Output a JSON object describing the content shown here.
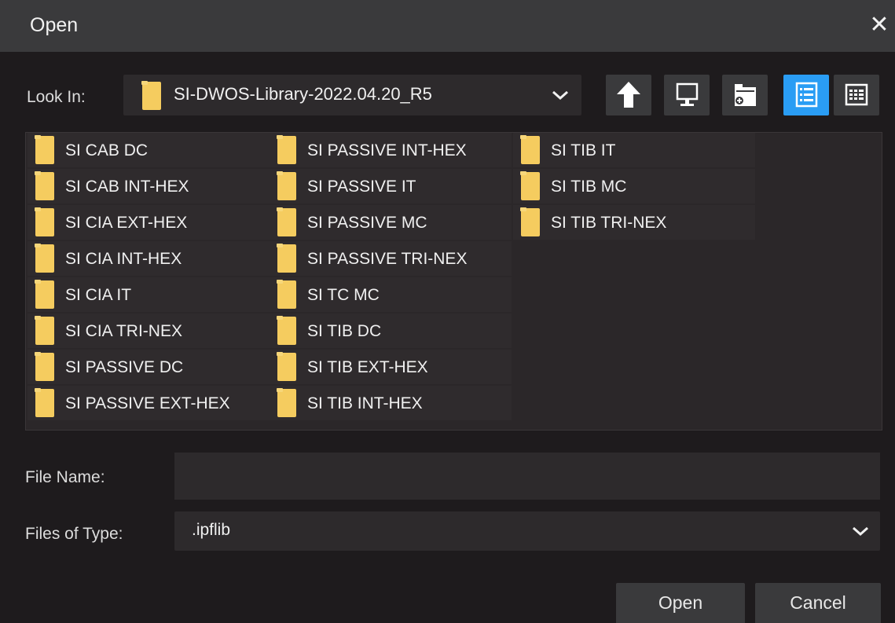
{
  "dialog": {
    "title": "Open",
    "close_glyph": "✕"
  },
  "look_in": {
    "label": "Look In:",
    "value": "SI-DWOS-Library-2022.04.20_R5",
    "icon": "folder-icon"
  },
  "toolbar": {
    "buttons": [
      {
        "name": "up-one-level-button",
        "icon": "arrow-up-icon"
      },
      {
        "name": "desktop-button",
        "icon": "monitor-icon"
      },
      {
        "name": "new-folder-button",
        "icon": "new-folder-icon"
      },
      {
        "name": "list-view-button",
        "icon": "list-view-icon",
        "active": true
      },
      {
        "name": "details-view-button",
        "icon": "details-view-icon",
        "active": false
      }
    ],
    "active_color": "#2a9df4"
  },
  "files": {
    "columns": [
      [
        "SI CAB DC",
        "SI CAB INT-HEX",
        "SI CIA EXT-HEX",
        "SI CIA INT-HEX",
        "SI CIA IT",
        "SI CIA TRI-NEX",
        "SI PASSIVE DC",
        "SI PASSIVE EXT-HEX"
      ],
      [
        "SI PASSIVE INT-HEX",
        "SI PASSIVE IT",
        "SI PASSIVE MC",
        "SI PASSIVE TRI-NEX",
        "SI TC MC",
        "SI TIB DC",
        "SI TIB EXT-HEX",
        "SI TIB INT-HEX"
      ],
      [
        "SI TIB IT",
        "SI TIB MC",
        "SI TIB TRI-NEX"
      ]
    ],
    "folder_color": "#f5cc5f"
  },
  "file_name": {
    "label": "File Name:",
    "value": "",
    "placeholder": ""
  },
  "files_of_type": {
    "label": "Files of Type:",
    "value": ".ipflib"
  },
  "buttons": {
    "open_label": "Open",
    "cancel_label": "Cancel"
  }
}
